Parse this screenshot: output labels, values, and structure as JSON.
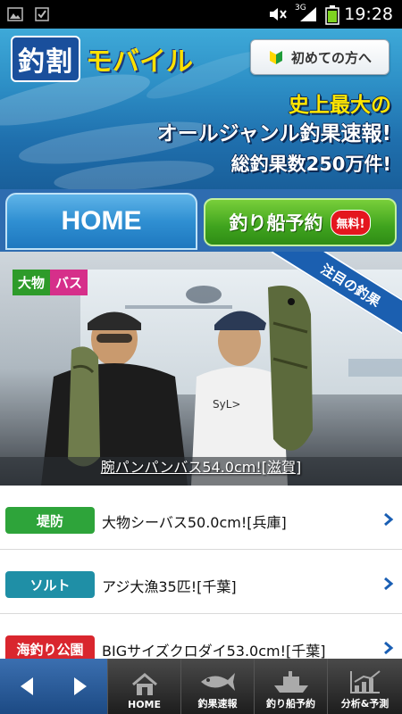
{
  "status_bar": {
    "time": "19:28",
    "network": "3G"
  },
  "header": {
    "logo_kanji": "釣割",
    "logo_text": "モバイル",
    "first_time_button": "初めての方へ",
    "promo_line1": "史上最大の",
    "promo_line2": "オールジャンル釣果速報!",
    "promo_line3": "総釣果数250万件!"
  },
  "tabs": {
    "home": "HOME",
    "boat_reservation": "釣り船予約",
    "free_badge": "無料!"
  },
  "featured": {
    "tag_big": "大物",
    "tag_bass": "バス",
    "ribbon": "注目の釣果",
    "caption": "腕パンパンバス54.0cm![滋賀]"
  },
  "list": [
    {
      "category": "堤防",
      "category_color": "#2ea43a",
      "text": "大物シーバス50.0cm![兵庫]"
    },
    {
      "category": "ソルト",
      "category_color": "#1f8fa6",
      "text": "アジ大漁35匹![千葉]"
    },
    {
      "category": "海釣り公園",
      "category_color": "#d9262e",
      "text": "BIGサイズクロダイ53.0cm![千葉]"
    }
  ],
  "bottom_nav": {
    "items": [
      {
        "label": "HOME",
        "icon": "home-icon"
      },
      {
        "label": "釣果速報",
        "icon": "fish-icon"
      },
      {
        "label": "釣り船予約",
        "icon": "boat-icon"
      },
      {
        "label": "分析&予測",
        "icon": "chart-icon"
      }
    ]
  },
  "colors": {
    "accent_blue": "#2e6cb0",
    "accent_green": "#3fa31e",
    "chevron": "#1a5fb4"
  }
}
